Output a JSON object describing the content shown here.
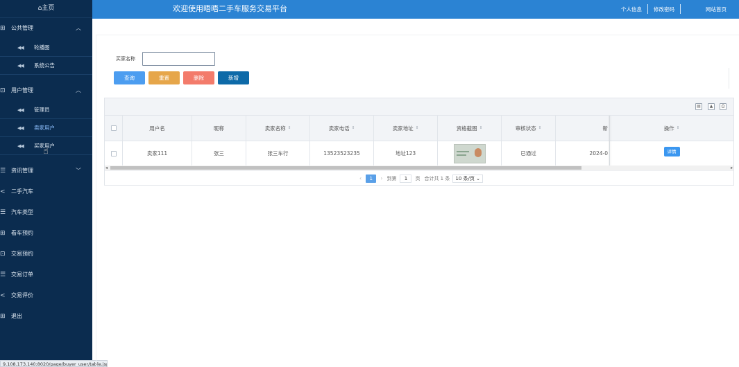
{
  "sidebar": {
    "home": "⌂主页",
    "groups": [
      {
        "label": "公共管理",
        "icon": "grid-icon",
        "expanded": true,
        "items": [
          {
            "label": "轮播图"
          },
          {
            "label": "系统公告"
          }
        ]
      },
      {
        "label": "用户管理",
        "icon": "box-icon",
        "expanded": true,
        "items": [
          {
            "label": "管理员"
          },
          {
            "label": "卖家用户",
            "active": true
          },
          {
            "label": "买家用户"
          }
        ]
      },
      {
        "label": "资讯管理",
        "icon": "list-icon",
        "expanded": false
      },
      {
        "label": "二手汽车",
        "icon": "share-icon"
      },
      {
        "label": "汽车类型",
        "icon": "list-icon"
      },
      {
        "label": "看车预约",
        "icon": "grid-icon"
      },
      {
        "label": "交易预约",
        "icon": "box-icon"
      },
      {
        "label": "交易订单",
        "icon": "list-icon"
      },
      {
        "label": "交易评价",
        "icon": "share-icon"
      },
      {
        "label": "退出",
        "icon": "grid-icon"
      }
    ]
  },
  "status_url": "9.108.173.140:8020/page/buyer_user/table.jsp",
  "topbar": {
    "title": "欢迎使用晤晤二手车服务交易平台",
    "links": [
      "个人信息",
      "修改密码",
      "网站首页"
    ],
    "color": "#2b83d3"
  },
  "search": {
    "label": "买家名称"
  },
  "buttons": {
    "query": "查询",
    "reset": "重置",
    "delete": "删除",
    "add": "新增"
  },
  "table": {
    "columns": [
      "用户名",
      "昵称",
      "卖家名称",
      "卖家电话",
      "卖家地址",
      "资格截图",
      "审核状态",
      "新",
      "操作"
    ],
    "rows": [
      {
        "username": "卖家111",
        "nickname": "张三",
        "seller_name": "张三车行",
        "phone": "13523523235",
        "address": "地址123",
        "status": "已通过",
        "date": "2024-0",
        "action": "详情"
      }
    ]
  },
  "pager": {
    "current": "1",
    "goto_label": "到第",
    "goto_value": "1",
    "page_unit": "页",
    "total": "合计共 1 条",
    "page_size": "10 条/页"
  }
}
